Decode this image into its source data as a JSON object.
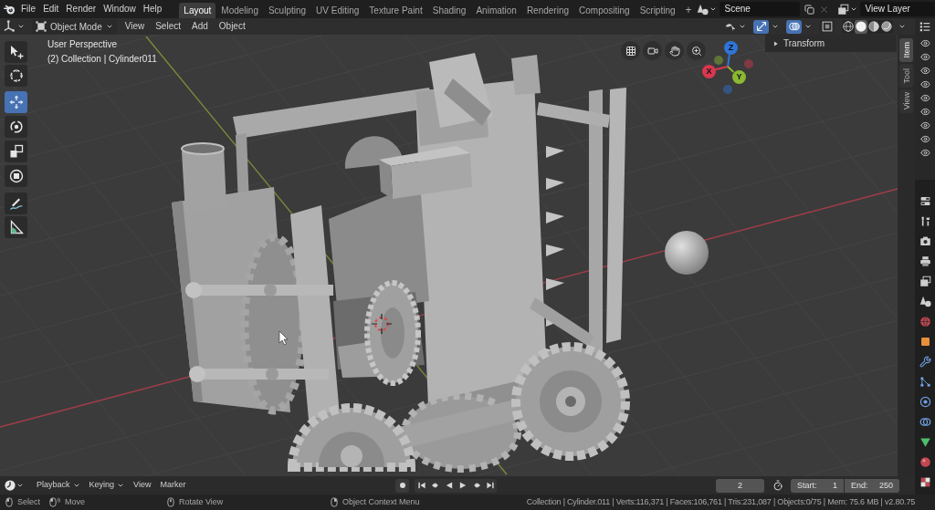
{
  "top_bar": {
    "menus": [
      "File",
      "Edit",
      "Render",
      "Window",
      "Help"
    ],
    "workspace_tabs": [
      {
        "label": "Layout",
        "selected": true
      },
      {
        "label": "Modeling",
        "selected": false
      },
      {
        "label": "Sculpting",
        "selected": false
      },
      {
        "label": "UV Editing",
        "selected": false
      },
      {
        "label": "Texture Paint",
        "selected": false
      },
      {
        "label": "Shading",
        "selected": false
      },
      {
        "label": "Animation",
        "selected": false
      },
      {
        "label": "Rendering",
        "selected": false
      },
      {
        "label": "Compositing",
        "selected": false
      },
      {
        "label": "Scripting",
        "selected": false
      }
    ],
    "add_workspace": "+",
    "scene": "Scene",
    "view_layer": "View Layer"
  },
  "viewport_header": {
    "mode": "Object Mode",
    "menus": [
      "View",
      "Select",
      "Add",
      "Object"
    ],
    "toggles": [
      {
        "kind": "gizmos",
        "on": true
      },
      {
        "kind": "overlays",
        "on": true
      },
      {
        "kind": "xray",
        "on": false
      }
    ],
    "shading_modes": [
      {
        "kind": "wireframe",
        "selected": false
      },
      {
        "kind": "solid",
        "selected": true
      },
      {
        "kind": "material",
        "selected": false
      },
      {
        "kind": "rendered",
        "selected": false
      }
    ]
  },
  "toolbar": [
    {
      "kind": "select_box",
      "selected": false
    },
    {
      "kind": "cursor",
      "selected": false
    },
    {
      "kind": "move",
      "selected": true
    },
    {
      "kind": "rotate",
      "selected": false
    },
    {
      "kind": "scale",
      "selected": false
    },
    {
      "kind": "transform",
      "selected": false
    },
    {
      "kind": "annotate",
      "selected": false
    },
    {
      "kind": "measure",
      "selected": false
    }
  ],
  "viewport": {
    "view_name": "User Perspective",
    "object_info": "(2) Collection | Cylinder011"
  },
  "navigation_gizmo": {
    "axes": [
      {
        "label": "Z",
        "color": "#2f74d9"
      },
      {
        "label": "X",
        "color": "#d8384f"
      },
      {
        "label": "Y",
        "color": "#8ab832"
      }
    ]
  },
  "sidebar": {
    "panels": [
      {
        "label": "Transform",
        "expanded": false
      }
    ],
    "tabs": [
      {
        "label": "Item",
        "selected": true
      },
      {
        "label": "Tool",
        "selected": false
      },
      {
        "label": "View",
        "selected": false
      }
    ]
  },
  "timeline": {
    "menus": [
      {
        "label": "Playback",
        "kind": "dropdown"
      },
      {
        "label": "Keying",
        "kind": "dropdown"
      },
      {
        "label": "View",
        "kind": "menu"
      },
      {
        "label": "Marker",
        "kind": "menu"
      }
    ],
    "current_frame": "2",
    "start_label": "Start:",
    "start": "1",
    "end_label": "End:",
    "end": "250"
  },
  "status_bar": {
    "hints": [
      {
        "kind": "left_click",
        "label": "Select"
      },
      {
        "kind": "left_drag",
        "label": "Move"
      },
      {
        "kind": "middle_drag",
        "label": "Rotate View"
      },
      {
        "kind": "right_click",
        "label": "Object Context Menu"
      }
    ],
    "stats": "Collection | Cylinder.011 | Verts:116,371 | Faces:106,761 | Tris:231,087 | Objects:0/75 | Mem: 75.6 MB | v2.80.75"
  }
}
